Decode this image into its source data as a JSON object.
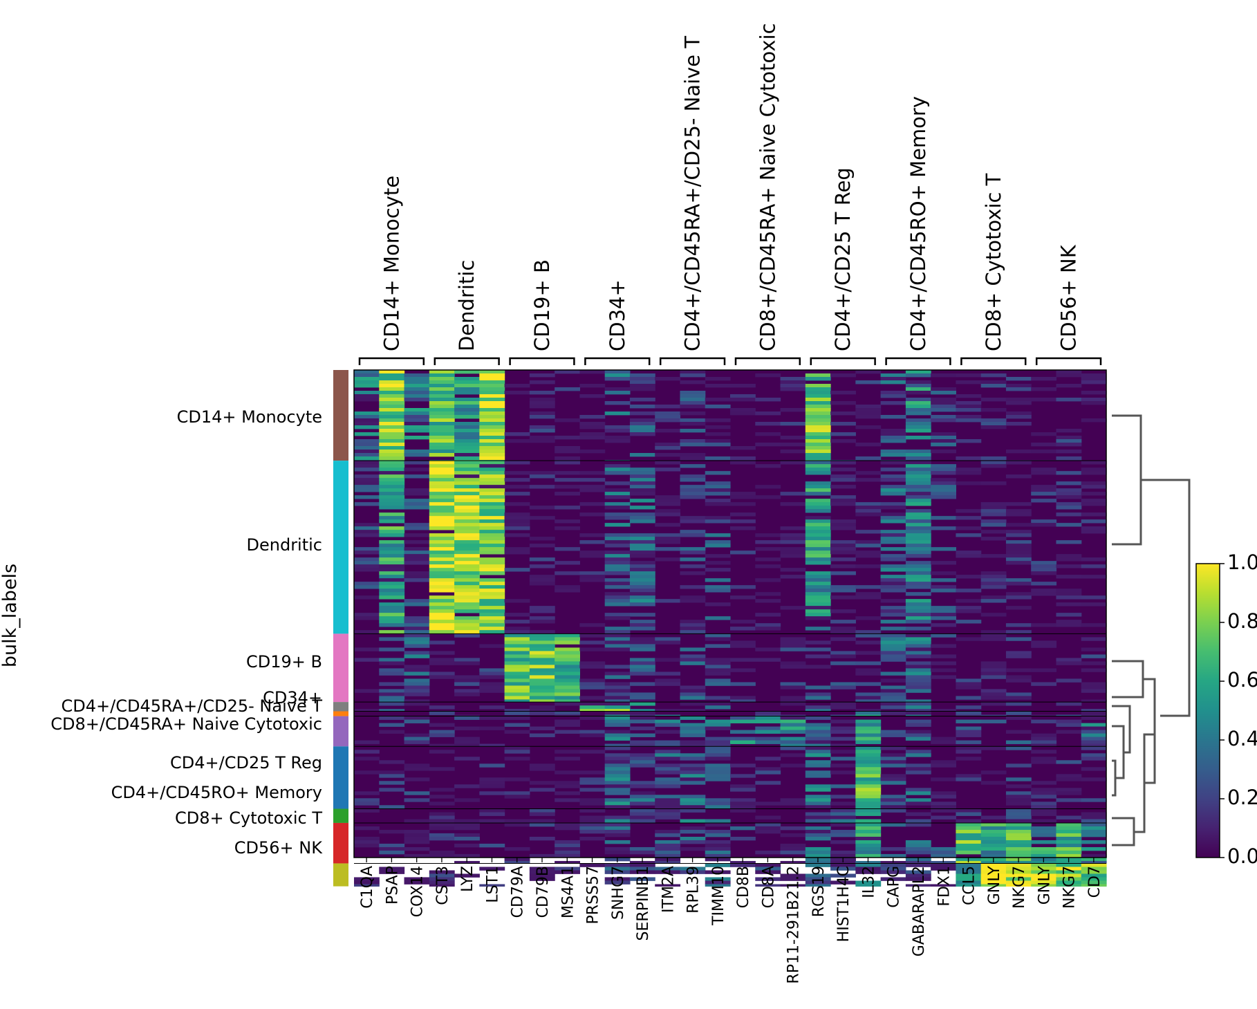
{
  "chart_data": {
    "type": "heatmap",
    "title": "",
    "ylabel": "bulk_labels",
    "genes": [
      "C1QA",
      "PSAP",
      "COX14",
      "CST3",
      "LYZ",
      "LST1",
      "CD79A",
      "CD79B",
      "MS4A1",
      "PRSS57",
      "SNHG7",
      "SERPINB1",
      "ITM2A",
      "RPL39",
      "TIMM10",
      "CD8B",
      "CD8A",
      "RP11-291B21.2",
      "RGS19",
      "HIST1H4C",
      "IL32",
      "CAPG",
      "GABARAPL2",
      "FDX1",
      "CCL5",
      "GNLY",
      "NKG7",
      "GNLY",
      "NKG7",
      "CD7"
    ],
    "gene_groups": [
      {
        "label": "CD14+ Monocyte",
        "start": 0,
        "end": 2
      },
      {
        "label": "Dendritic",
        "start": 3,
        "end": 5
      },
      {
        "label": "CD19+ B",
        "start": 6,
        "end": 8
      },
      {
        "label": "CD34+",
        "start": 9,
        "end": 11
      },
      {
        "label": "CD4+/CD45RA+/CD25- Naive T",
        "start": 12,
        "end": 14
      },
      {
        "label": "CD8+/CD45RA+ Naive Cytotoxic",
        "start": 15,
        "end": 17
      },
      {
        "label": "CD4+/CD25 T Reg",
        "start": 18,
        "end": 20
      },
      {
        "label": "CD4+/CD45RO+ Memory",
        "start": 21,
        "end": 23
      },
      {
        "label": "CD8+ Cytotoxic T",
        "start": 24,
        "end": 26
      },
      {
        "label": "CD56+ NK",
        "start": 27,
        "end": 29
      }
    ],
    "cell_groups": [
      {
        "label": "CD14+ Monocyte",
        "fraction": 0.186,
        "color": "#8c564b"
      },
      {
        "label": "Dendritic",
        "fraction": 0.355,
        "color": "#17becf"
      },
      {
        "label": "CD19+ B",
        "fraction": 0.14,
        "color": "#e377c2"
      },
      {
        "label": "CD34+",
        "fraction": 0.019,
        "color": "#7f7f7f"
      },
      {
        "label": "CD4+/CD45RA+/CD25- Naive T",
        "fraction": 0.01,
        "color": "#ff7f0e"
      },
      {
        "label": "CD8+/CD45RA+ Naive Cytotoxic",
        "fraction": 0.062,
        "color": "#9467bd"
      },
      {
        "label": "CD4+/CD25 T Reg",
        "fraction": 0.128,
        "color": "#1f77b4"
      },
      {
        "label": "CD4+/CD45RO+ Memory",
        "fraction": 0.029,
        "color": "#2ca02c"
      },
      {
        "label": "CD8+ Cytotoxic T",
        "fraction": 0.083,
        "color": "#d62728"
      },
      {
        "label": "CD56+ NK",
        "fraction": 0.047,
        "color": "#bcbd22"
      }
    ],
    "mean_expression": [
      [
        0.45,
        0.8,
        0.4,
        0.7,
        0.55,
        0.85,
        0.05,
        0.1,
        0.02,
        0.03,
        0.3,
        0.25,
        0.05,
        0.15,
        0.15,
        0.02,
        0.02,
        0.02,
        0.75,
        0.05,
        0.08,
        0.25,
        0.45,
        0.15,
        0.05,
        0.05,
        0.08,
        0.05,
        0.08,
        0.05
      ],
      [
        0.15,
        0.6,
        0.15,
        0.88,
        0.85,
        0.8,
        0.02,
        0.05,
        0.01,
        0.02,
        0.3,
        0.3,
        0.05,
        0.2,
        0.2,
        0.02,
        0.02,
        0.02,
        0.55,
        0.05,
        0.08,
        0.3,
        0.4,
        0.15,
        0.05,
        0.05,
        0.08,
        0.05,
        0.08,
        0.05
      ],
      [
        0.05,
        0.15,
        0.25,
        0.05,
        0.05,
        0.08,
        0.7,
        0.75,
        0.65,
        0.02,
        0.3,
        0.25,
        0.1,
        0.2,
        0.2,
        0.05,
        0.05,
        0.05,
        0.2,
        0.15,
        0.15,
        0.3,
        0.35,
        0.15,
        0.05,
        0.05,
        0.05,
        0.05,
        0.05,
        0.05
      ],
      [
        0.05,
        0.15,
        0.1,
        0.05,
        0.05,
        0.05,
        0.05,
        0.05,
        0.02,
        0.65,
        0.7,
        0.6,
        0.2,
        0.25,
        0.2,
        0.05,
        0.05,
        0.05,
        0.2,
        0.1,
        0.1,
        0.2,
        0.3,
        0.15,
        0.05,
        0.05,
        0.05,
        0.05,
        0.05,
        0.05
      ],
      [
        0.05,
        0.1,
        0.1,
        0.05,
        0.05,
        0.05,
        0.05,
        0.05,
        0.02,
        0.05,
        0.3,
        0.2,
        0.4,
        0.3,
        0.25,
        0.2,
        0.2,
        0.15,
        0.25,
        0.15,
        0.45,
        0.2,
        0.25,
        0.15,
        0.1,
        0.05,
        0.1,
        0.05,
        0.1,
        0.2
      ],
      [
        0.05,
        0.1,
        0.1,
        0.05,
        0.05,
        0.05,
        0.05,
        0.05,
        0.02,
        0.05,
        0.3,
        0.25,
        0.35,
        0.3,
        0.3,
        0.45,
        0.4,
        0.45,
        0.25,
        0.15,
        0.55,
        0.2,
        0.25,
        0.15,
        0.15,
        0.1,
        0.15,
        0.1,
        0.15,
        0.35
      ],
      [
        0.05,
        0.15,
        0.1,
        0.05,
        0.05,
        0.05,
        0.05,
        0.05,
        0.02,
        0.05,
        0.35,
        0.25,
        0.25,
        0.3,
        0.3,
        0.05,
        0.05,
        0.05,
        0.35,
        0.2,
        0.7,
        0.2,
        0.3,
        0.15,
        0.1,
        0.05,
        0.1,
        0.05,
        0.1,
        0.1
      ],
      [
        0.05,
        0.15,
        0.1,
        0.05,
        0.05,
        0.05,
        0.05,
        0.05,
        0.02,
        0.05,
        0.3,
        0.25,
        0.25,
        0.3,
        0.25,
        0.05,
        0.05,
        0.05,
        0.3,
        0.2,
        0.55,
        0.2,
        0.3,
        0.15,
        0.15,
        0.05,
        0.1,
        0.05,
        0.1,
        0.1
      ],
      [
        0.05,
        0.1,
        0.1,
        0.05,
        0.05,
        0.05,
        0.05,
        0.05,
        0.02,
        0.05,
        0.3,
        0.2,
        0.2,
        0.25,
        0.25,
        0.15,
        0.15,
        0.05,
        0.3,
        0.15,
        0.6,
        0.2,
        0.25,
        0.15,
        0.75,
        0.55,
        0.65,
        0.55,
        0.65,
        0.45
      ],
      [
        0.05,
        0.1,
        0.2,
        0.05,
        0.05,
        0.05,
        0.05,
        0.05,
        0.02,
        0.05,
        0.3,
        0.2,
        0.15,
        0.25,
        0.25,
        0.1,
        0.1,
        0.05,
        0.25,
        0.15,
        0.35,
        0.2,
        0.25,
        0.15,
        0.6,
        0.9,
        0.85,
        0.9,
        0.85,
        0.75
      ]
    ],
    "colorbar": {
      "ticks": [
        "0.0",
        "0.2",
        "0.4",
        "0.6",
        "0.8",
        "1.0"
      ],
      "range": [
        0,
        1
      ],
      "colormap": "viridis"
    }
  }
}
